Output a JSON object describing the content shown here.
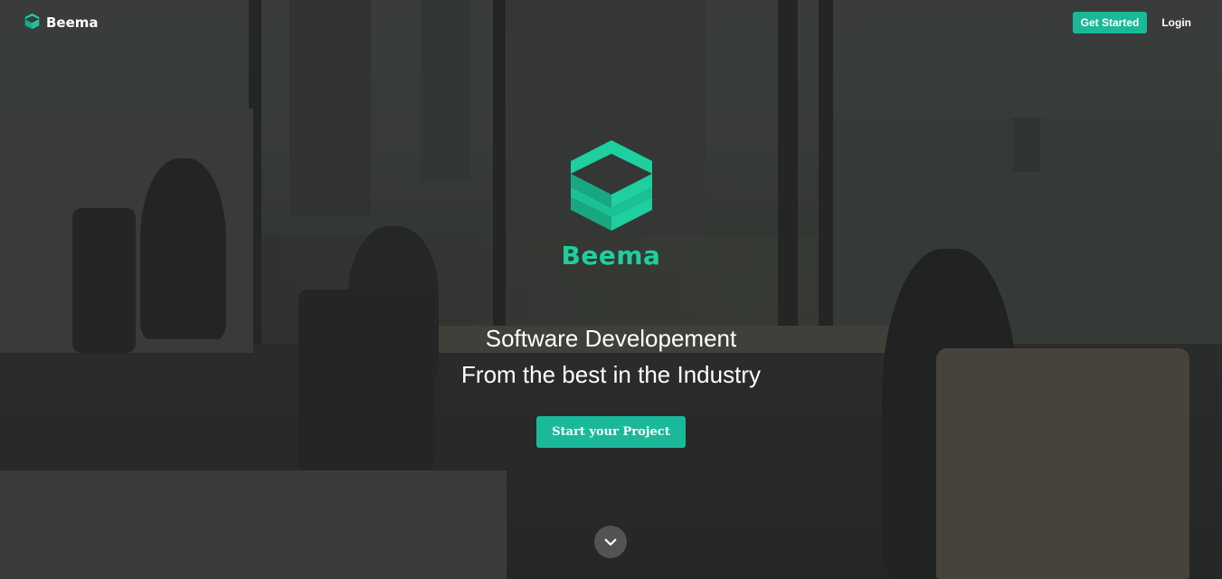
{
  "header": {
    "brand_name": "Beema",
    "get_started_label": "Get Started",
    "login_label": "Login"
  },
  "hero": {
    "brand_name": "Beema",
    "tagline_line1": "Software Developement",
    "tagline_line2": "From the best in the Industry",
    "cta_label": "Start your Project"
  },
  "icons": {
    "logo": "beema-logo-icon",
    "scroll": "chevron-down-icon"
  },
  "colors": {
    "accent": "#19b999",
    "brand_text": "#1ecf9f"
  }
}
